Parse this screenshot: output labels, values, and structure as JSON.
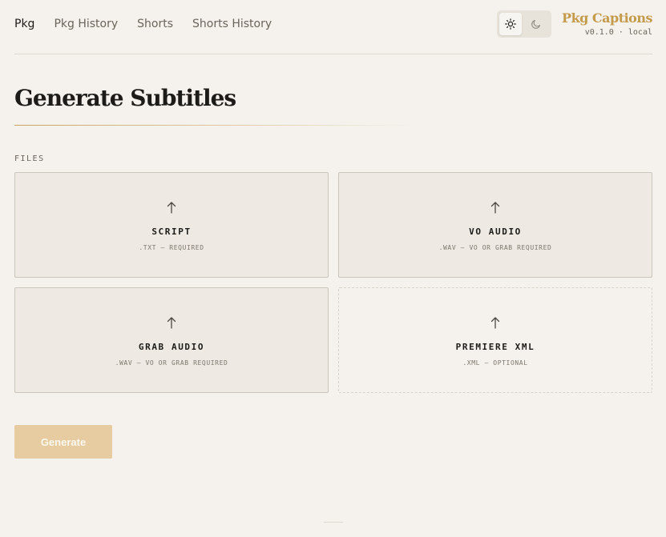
{
  "nav": {
    "items": [
      {
        "label": "Pkg",
        "active": true
      },
      {
        "label": "Pkg History",
        "active": false
      },
      {
        "label": "Shorts",
        "active": false
      },
      {
        "label": "Shorts History",
        "active": false
      }
    ]
  },
  "theme_toggle": {
    "options": [
      "sun-icon",
      "moon-icon"
    ],
    "selected": "sun-icon"
  },
  "brand": {
    "title": "Pkg Captions",
    "version": "v0.1.0 · local",
    "accent_color": "#c49a4b"
  },
  "page": {
    "title": "Generate Subtitles"
  },
  "files": {
    "label": "FILES",
    "cards": [
      {
        "title": "SCRIPT",
        "subtitle": ".TXT — REQUIRED",
        "icon": "upload-arrow-icon"
      },
      {
        "title": "VO AUDIO",
        "subtitle": ".WAV — VO OR GRAB REQUIRED",
        "icon": "upload-arrow-icon"
      },
      {
        "title": "GRAB AUDIO",
        "subtitle": ".WAV — VO OR GRAB REQUIRED",
        "icon": "upload-arrow-icon"
      },
      {
        "title": "PREMIERE XML",
        "subtitle": ".XML — OPTIONAL",
        "icon": "upload-arrow-icon"
      }
    ]
  },
  "actions": {
    "generate_label": "Generate",
    "generate_color": "#e6cca0"
  }
}
